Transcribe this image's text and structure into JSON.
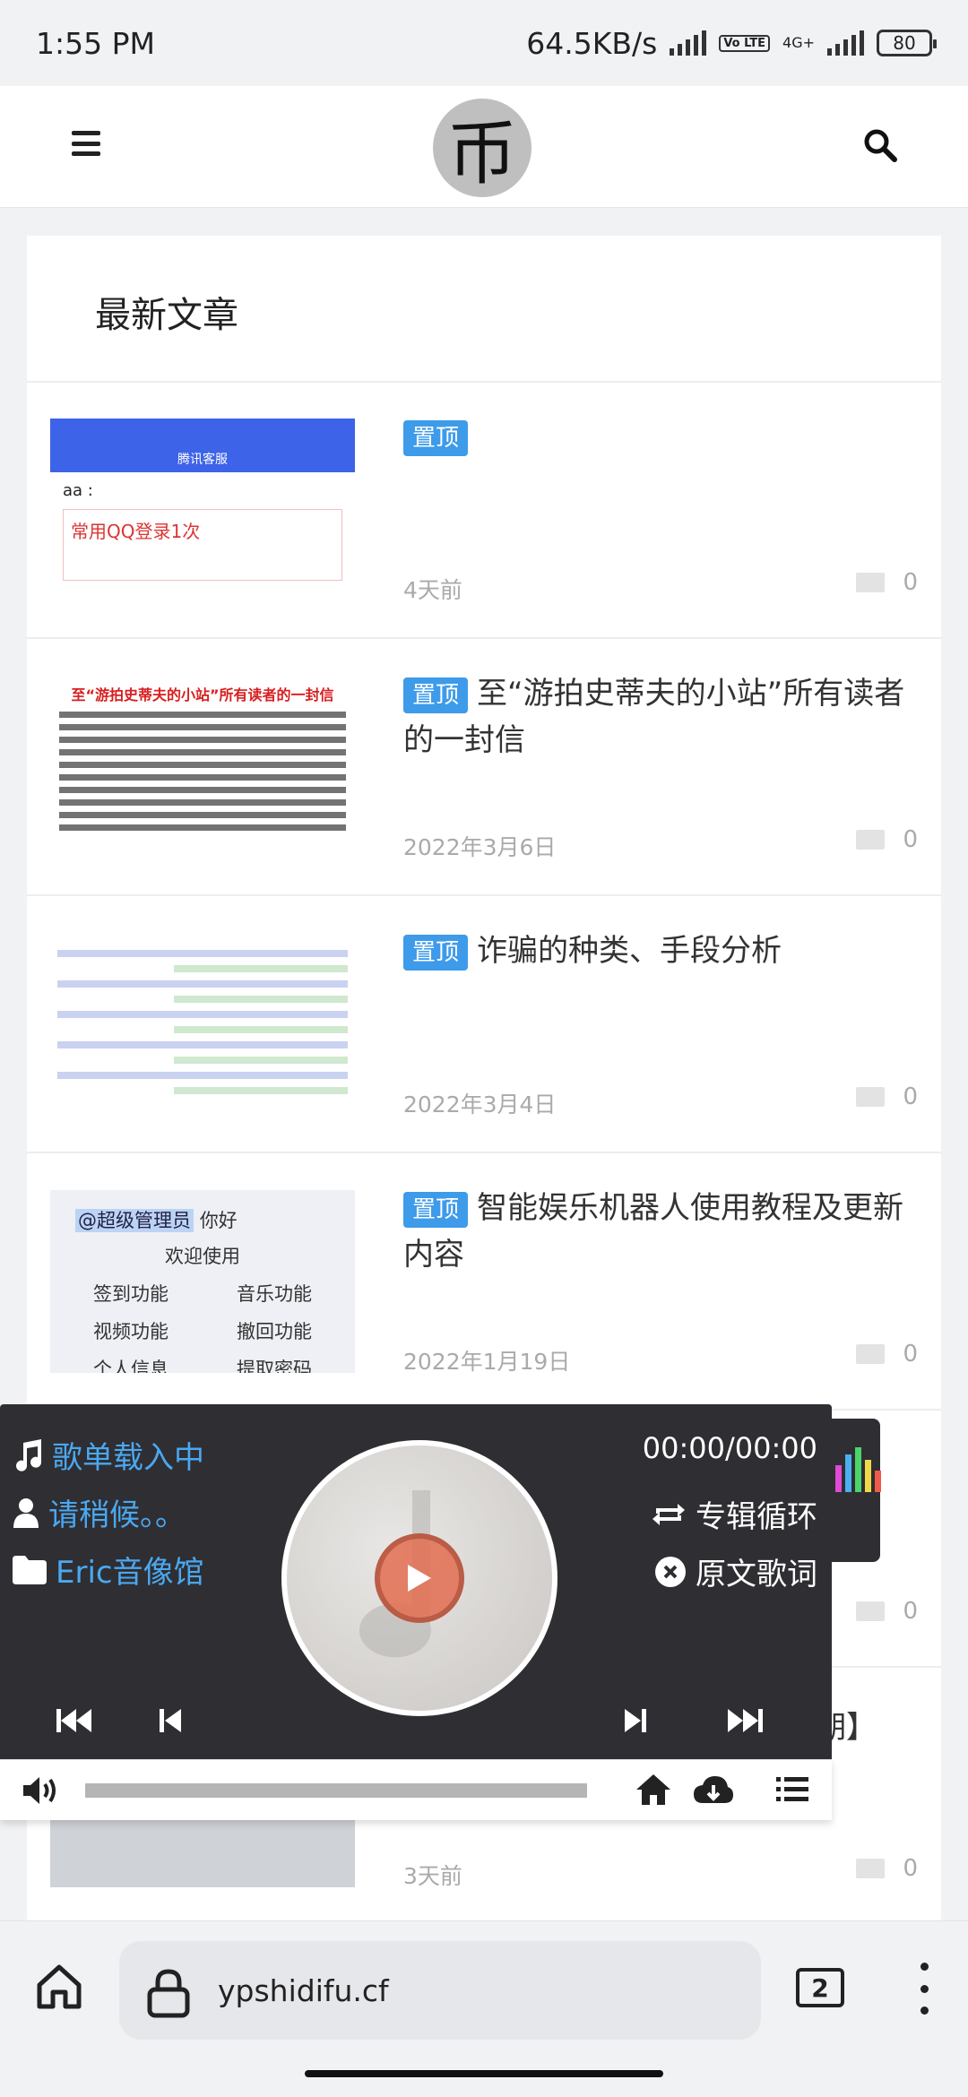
{
  "status_bar": {
    "time": "1:55 PM",
    "net_speed": "64.5KB/s",
    "volte": "Vo LTE",
    "network": "4G+",
    "battery": "80"
  },
  "header": {
    "logo_char": "币"
  },
  "section": {
    "title": "最新文章"
  },
  "posts": [
    {
      "badge": "置顶",
      "title": "",
      "date": "4天前",
      "comments": "0",
      "thumb": {
        "top_title": "腾讯客服",
        "line": "aa :",
        "warn": "常用QQ登录1次"
      }
    },
    {
      "badge": "置顶",
      "title": "至“游拍史蒂夫的小站”所有读者的一封信",
      "date": "2022年3月6日",
      "comments": "0",
      "thumb": {
        "heading": "至“游拍史蒂夫的小站”所有读者的一封信"
      }
    },
    {
      "badge": "置顶",
      "title": "诈骗的种类、手段分析",
      "date": "2022年3月4日",
      "comments": "0"
    },
    {
      "badge": "置顶",
      "title": "智能娱乐机器人使用教程及更新内容",
      "date": "2022年1月19日",
      "comments": "0",
      "thumb": {
        "mention": "@超级管理员",
        "greet": "你好",
        "welcome": "欢迎使用",
        "features": [
          "签到功能",
          "音乐功能",
          "视频功能",
          "撤回功能",
          "个人信息",
          "提取密码"
        ]
      }
    },
    {
      "comments": "0"
    },
    {
      "title_tail": "期】",
      "date": "3天前",
      "comments": "0"
    }
  ],
  "player": {
    "playlist": "歌单载入中",
    "status": "请稍候。。",
    "library": "Eric音像馆",
    "time": "00:00/00:00",
    "loop_mode": "专辑循环",
    "lyrics": "原文歌词"
  },
  "browser": {
    "url": "ypshidifu.cf",
    "tab_count": "2"
  }
}
